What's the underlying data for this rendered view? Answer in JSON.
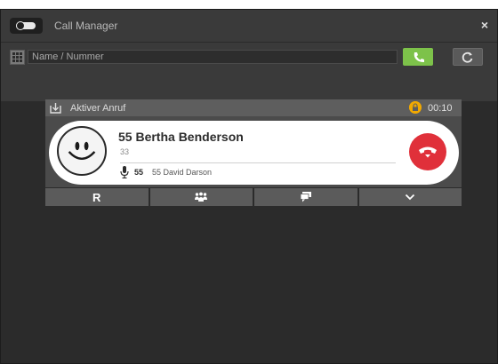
{
  "window": {
    "title": "Call Manager",
    "close_label": "×"
  },
  "search": {
    "placeholder": "Name / Nummer",
    "value": ""
  },
  "active_call": {
    "header_label": "Aktiver Anruf",
    "duration": "00:10",
    "caller_name": "55 Bertha Benderson",
    "caller_extension": "33",
    "via_extension": "55",
    "via_name": "55 David Darson",
    "status_colors": {
      "lock": "#f2a900",
      "hangup": "#e0303a",
      "dial": "#7dc24a"
    }
  },
  "actions": [
    {
      "label": "R",
      "icon": "r-letter"
    },
    {
      "label": "",
      "icon": "conference-icon"
    },
    {
      "label": "",
      "icon": "chat-icon"
    },
    {
      "label": "",
      "icon": "chevron-down-icon"
    }
  ]
}
